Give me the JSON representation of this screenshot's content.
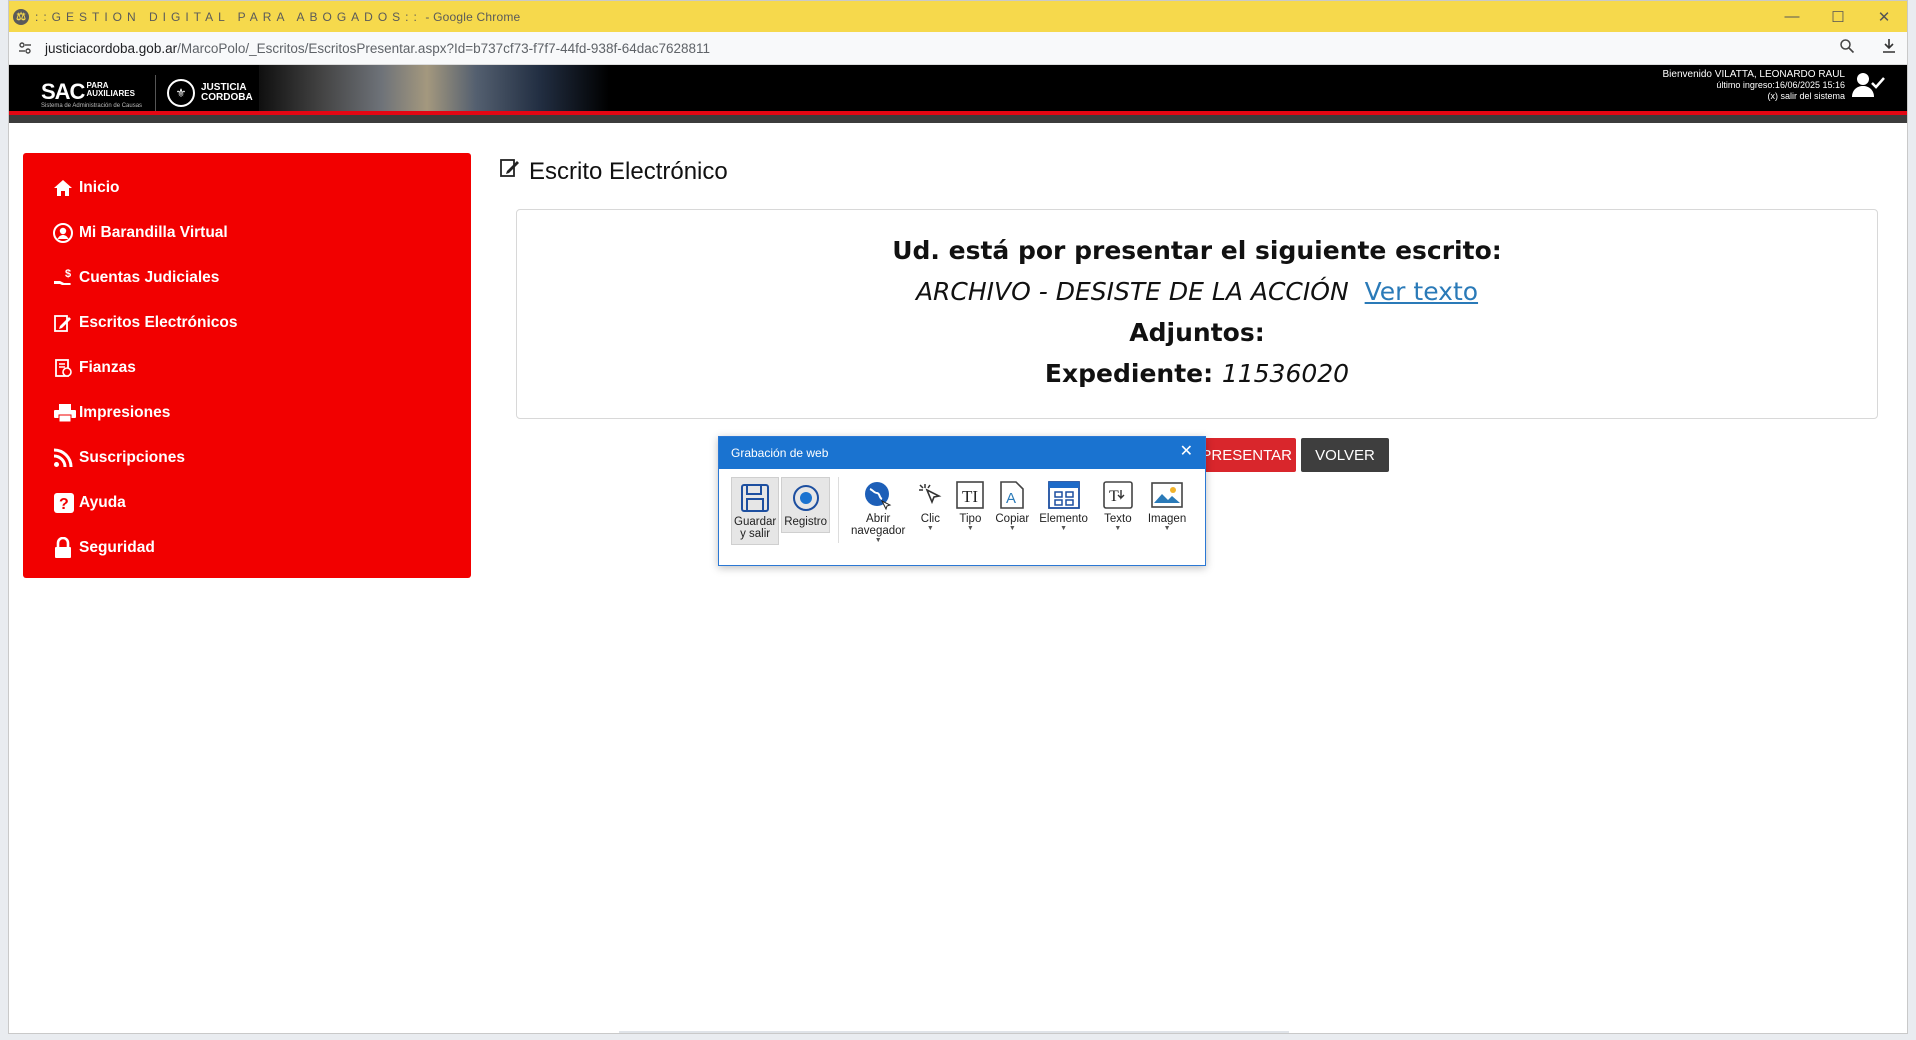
{
  "browser": {
    "window_title_prefix": "::GESTION  DIGITAL  PARA  ABOGADOS::",
    "window_title_suffix": " - Google Chrome",
    "url_host": "justiciacordoba.gob.ar",
    "url_path": "/MarcoPolo/_Escritos/EscritosPresentar.aspx?Id=b737cf73-f7f7-44fd-938f-64dac7628811",
    "controls": {
      "minimize": "—",
      "maximize": "☐",
      "close": "✕"
    }
  },
  "header": {
    "logo_sac": "SAC",
    "logo_sac_small1": "PARA",
    "logo_sac_small2": "AUXILIARES",
    "logo_sac_sub": "Sistema de Administración de Causas",
    "logo_justicia1": "JUSTICIA",
    "logo_justicia2": "CORDOBA",
    "welcome": "Bienvenido VILATTA, LEONARDO RAUL",
    "last_login": "último ingreso:16/06/2025 15:16",
    "logout": "(x) salir del sistema"
  },
  "sidebar": {
    "items": [
      {
        "label": "Inicio",
        "icon": "home-icon"
      },
      {
        "label": "Mi Barandilla Virtual",
        "icon": "user-circle-icon"
      },
      {
        "label": "Cuentas Judiciales",
        "icon": "hand-money-icon"
      },
      {
        "label": "Escritos Electrónicos",
        "icon": "edit-document-icon"
      },
      {
        "label": "Fianzas",
        "icon": "receipt-icon"
      },
      {
        "label": "Impresiones",
        "icon": "printer-icon"
      },
      {
        "label": "Suscripciones",
        "icon": "rss-icon"
      },
      {
        "label": "Ayuda",
        "icon": "help-icon"
      },
      {
        "label": "Seguridad",
        "icon": "lock-icon"
      }
    ]
  },
  "main": {
    "title": "Escrito Electrónico",
    "card": {
      "heading": "Ud. está por presentar el siguiente escrito:",
      "document_name": "ARCHIVO - DESISTE DE LA ACCIÓN",
      "view_link": "Ver texto",
      "attachments_label": "Adjuntos:",
      "case_label": "Expediente:",
      "case_number": "11536020"
    },
    "buttons": {
      "presentar": "N PRESENTAR",
      "volver": "VOLVER"
    }
  },
  "recorder": {
    "title": "Grabación de web",
    "tools": [
      {
        "label1": "Guardar",
        "label2": "y salir",
        "icon": "save-icon"
      },
      {
        "label1": "Registro",
        "label2": "",
        "icon": "record-icon"
      },
      {
        "label1": "Abrir",
        "label2": "navegador",
        "icon": "globe-icon"
      },
      {
        "label1": "Clic",
        "label2": "",
        "icon": "click-icon"
      },
      {
        "label1": "Tipo",
        "label2": "",
        "icon": "type-icon"
      },
      {
        "label1": "Copiar",
        "label2": "",
        "icon": "copy-icon"
      },
      {
        "label1": "Elemento",
        "label2": "",
        "icon": "element-icon"
      },
      {
        "label1": "Texto",
        "label2": "",
        "icon": "text-icon"
      },
      {
        "label1": "Imagen",
        "label2": "",
        "icon": "image-icon"
      }
    ]
  },
  "colors": {
    "sidebar": "#f20000",
    "titlebar": "#f6d94c",
    "recorder_header": "#1a73d0",
    "link": "#2a7ab8"
  }
}
